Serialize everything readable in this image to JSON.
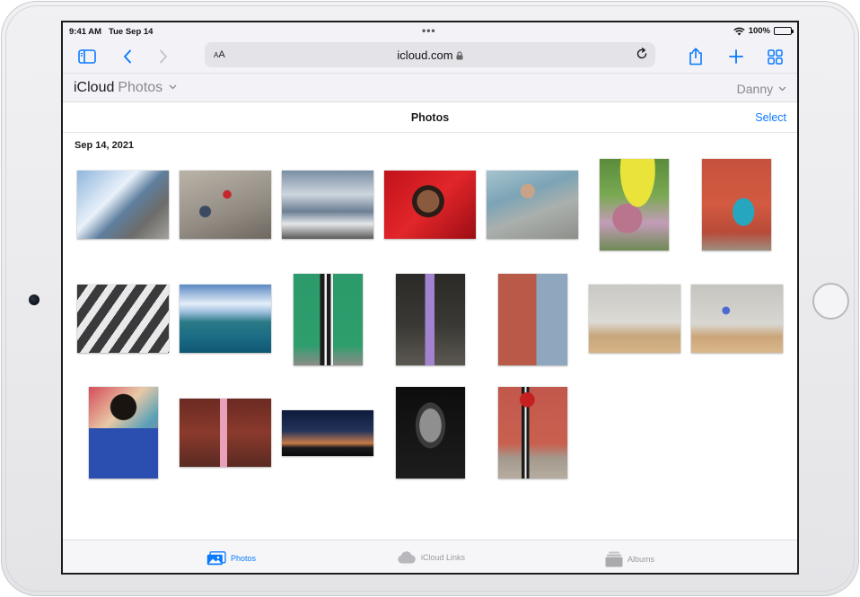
{
  "status_bar": {
    "time": "9:41 AM",
    "date": "Tue Sep 14",
    "battery": "100%",
    "battery_level": 1.0
  },
  "browser": {
    "text_size_label": "AA",
    "url": "icloud.com"
  },
  "icloud_header": {
    "brand": "iCloud",
    "app": "Photos",
    "user": "Danny"
  },
  "photos_bar": {
    "title": "Photos",
    "select_label": "Select"
  },
  "library": {
    "date_label": "Sep 14, 2021"
  },
  "tab_bar": {
    "tabs": [
      {
        "label": "Photos"
      },
      {
        "label": "iCloud Links"
      },
      {
        "label": "Albums"
      }
    ]
  },
  "icons": [
    "sidebar-icon",
    "back-chevron-icon",
    "forward-chevron-icon",
    "lock-icon",
    "reload-icon",
    "share-icon",
    "plus-icon",
    "tabs-grid-icon",
    "wifi-icon",
    "battery-icon",
    "chevron-down-icon",
    "photos-tab-icon",
    "cloud-icon",
    "albums-icon"
  ],
  "colors": {
    "accent": "#0a7aff",
    "toolbar_bg": "#f2f2f7"
  }
}
